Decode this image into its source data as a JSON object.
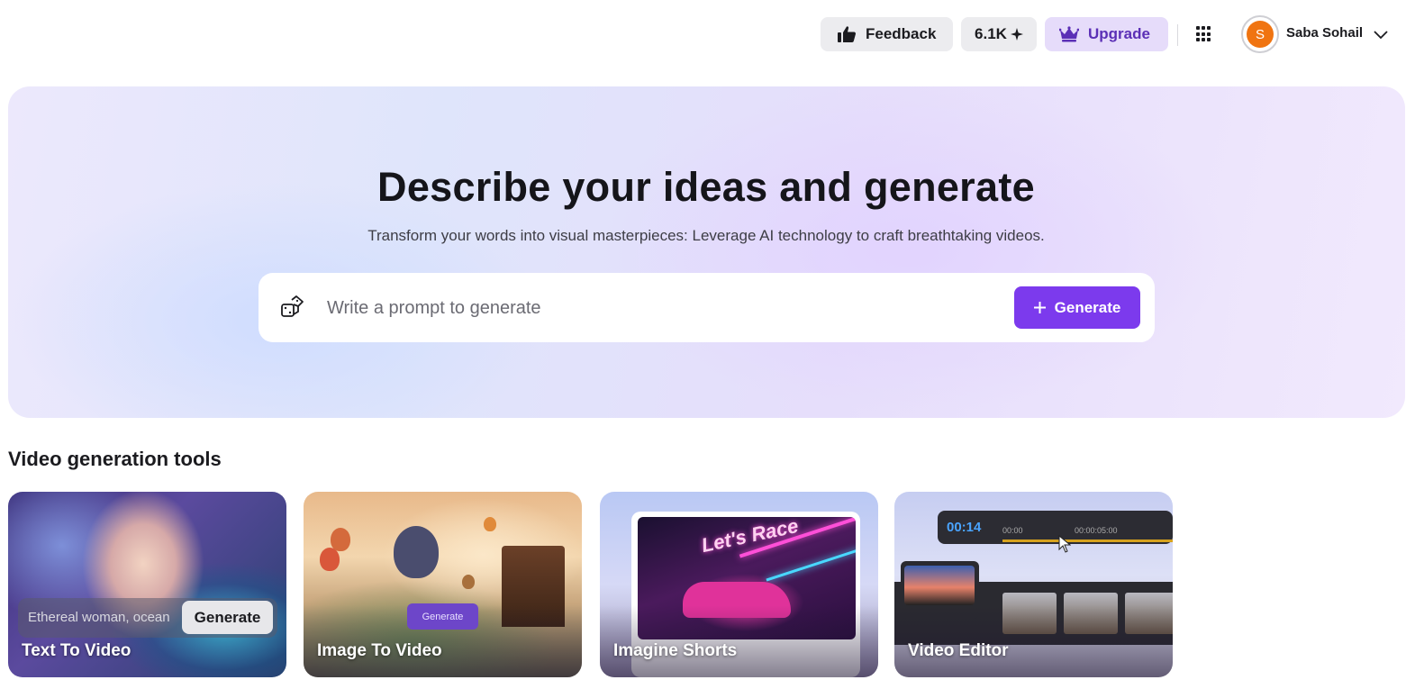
{
  "header": {
    "feedback_label": "Feedback",
    "credits_label": "6.1K",
    "upgrade_label": "Upgrade",
    "user": {
      "initial": "S",
      "name": "Saba Sohail"
    }
  },
  "hero": {
    "title": "Describe your ideas and generate",
    "subtitle": "Transform your words into visual masterpieces: Leverage AI technology to craft breathtaking videos.",
    "prompt_placeholder": "Write a prompt to generate",
    "generate_label": "Generate"
  },
  "tools": {
    "section_title": "Video generation tools",
    "cards": [
      {
        "label": "Text To Video",
        "preview_input_text": "Ethereal woman, ocean",
        "preview_button": "Generate"
      },
      {
        "label": "Image To Video",
        "preview_button": "Generate"
      },
      {
        "label": "Imagine Shorts",
        "preview_text": "Let's Race"
      },
      {
        "label": "Video Editor",
        "preview_time": "00:14",
        "preview_ticks": [
          "00:00",
          "00:00:05:00"
        ]
      }
    ]
  },
  "colors": {
    "accent": "#7c3aed",
    "upgrade_bg": "#e6dcfa",
    "upgrade_text": "#5b2fb6",
    "avatar": "#f07411"
  }
}
